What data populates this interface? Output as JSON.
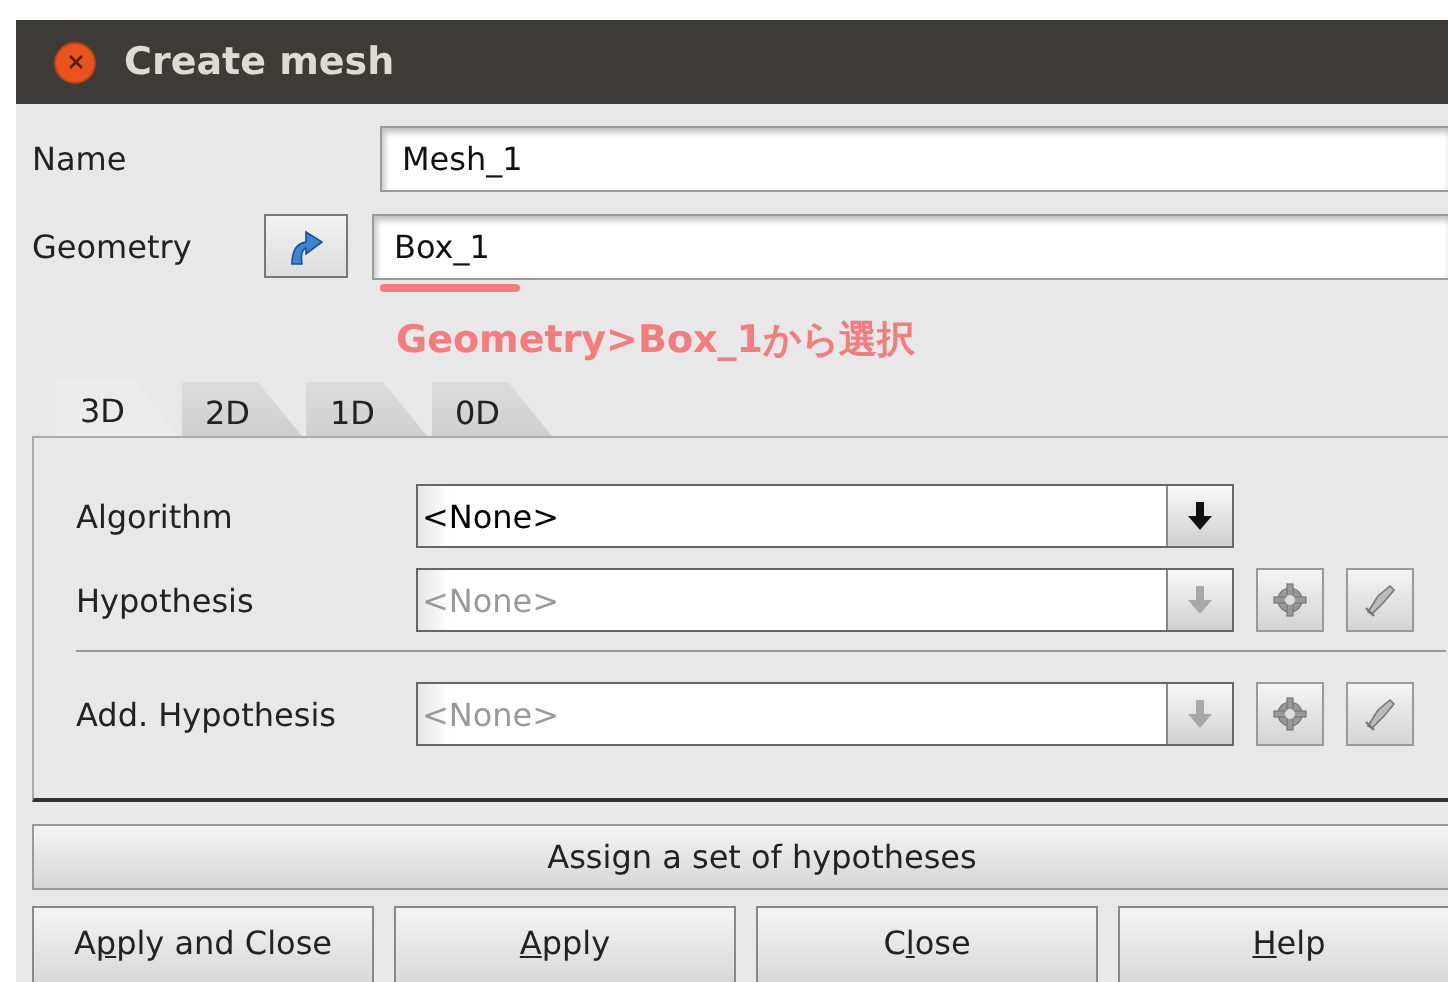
{
  "window": {
    "title": "Create mesh"
  },
  "name_field": {
    "label": "Name",
    "value": "Mesh_1"
  },
  "geometry_field": {
    "label": "Geometry",
    "value": "Box_1"
  },
  "annotation": {
    "text": "Geometry>Box_1から選択"
  },
  "tabs": [
    {
      "label": "3D",
      "selected": true
    },
    {
      "label": "2D",
      "selected": false
    },
    {
      "label": "1D",
      "selected": false
    },
    {
      "label": "0D",
      "selected": false
    }
  ],
  "rows": [
    {
      "kind": "combo",
      "label": "Algorithm",
      "value": "<None>",
      "disabled": false,
      "tools": false
    },
    {
      "kind": "combo",
      "label": "Hypothesis",
      "value": "<None>",
      "disabled": true,
      "tools": true
    },
    {
      "kind": "separator"
    },
    {
      "kind": "combo",
      "label": "Add. Hypothesis",
      "value": "<None>",
      "disabled": true,
      "tools": true
    }
  ],
  "assign_button": "Assign a set of hypotheses",
  "buttons": [
    {
      "before": "A",
      "key": "p",
      "after": "ply and Close"
    },
    {
      "key": "A",
      "after": "pply"
    },
    {
      "before": "C",
      "key": "l",
      "after": "ose"
    },
    {
      "key": "H",
      "after": "elp"
    }
  ]
}
